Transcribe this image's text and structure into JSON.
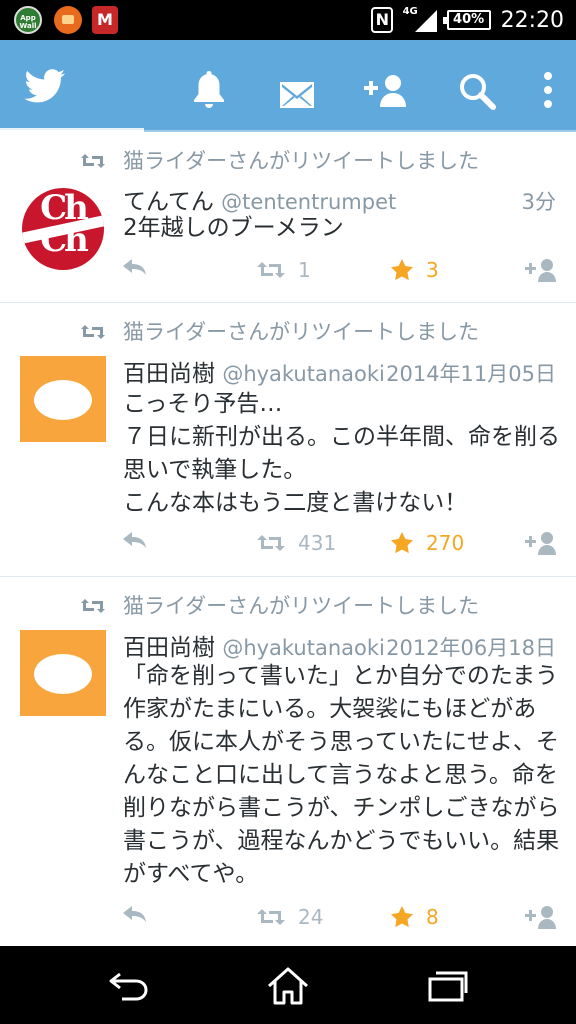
{
  "status_bar": {
    "app_icons": [
      "app-wall-icon",
      "folder-icon",
      "mcafee-icon"
    ],
    "app_wall_label": "App Wall",
    "security_app_label": "M",
    "network": "4G",
    "battery": "40%",
    "time": "22:20"
  },
  "appbar": {
    "icons": [
      "twitter-bird-icon",
      "notifications-icon",
      "messages-icon",
      "follow-icon",
      "search-icon",
      "more-icon"
    ],
    "color": "#5fa9dd"
  },
  "tweets": [
    {
      "retweeted_by": "猫ライダーさんがリツイートしました",
      "name": "てんてん",
      "handle": "@tententrumpet",
      "time": "3分",
      "text": "2年越しのブーメラン",
      "retweets": "1",
      "favorites": "3",
      "avatar": "chch-logo"
    },
    {
      "retweeted_by": "猫ライダーさんがリツイートしました",
      "name": "百田尚樹",
      "handle": "@hyakutanaoki",
      "time": "2014年11月05日",
      "text": "こっそり予告…\n７日に新刊が出る。この半年間、命を削る思いで執筆した。\nこんな本はもう二度と書けない！",
      "retweets": "431",
      "favorites": "270",
      "avatar": "default-egg"
    },
    {
      "retweeted_by": "猫ライダーさんがリツイートしました",
      "name": "百田尚樹",
      "handle": "@hyakutanaoki",
      "time": "2012年06月18日",
      "text": "「命を削って書いた」とか自分でのたまう作家がたまにいる。大袈裟にもほどがある。仮に本人がそう思っていたにせよ、そんなこと口に出して言うなよと思う。命を削りながら書こうが、チンポしごきながら書こうが、過程なんかどうでもいい。結果がすべてや。",
      "retweets": "24",
      "favorites": "8",
      "avatar": "default-egg"
    }
  ],
  "colors": {
    "twitter_blue": "#5fa9dd",
    "favorite": "#f5a623",
    "secondary_text": "#8899a6"
  },
  "nav_bar": {
    "icons": [
      "back-icon",
      "home-icon",
      "recents-icon"
    ]
  }
}
